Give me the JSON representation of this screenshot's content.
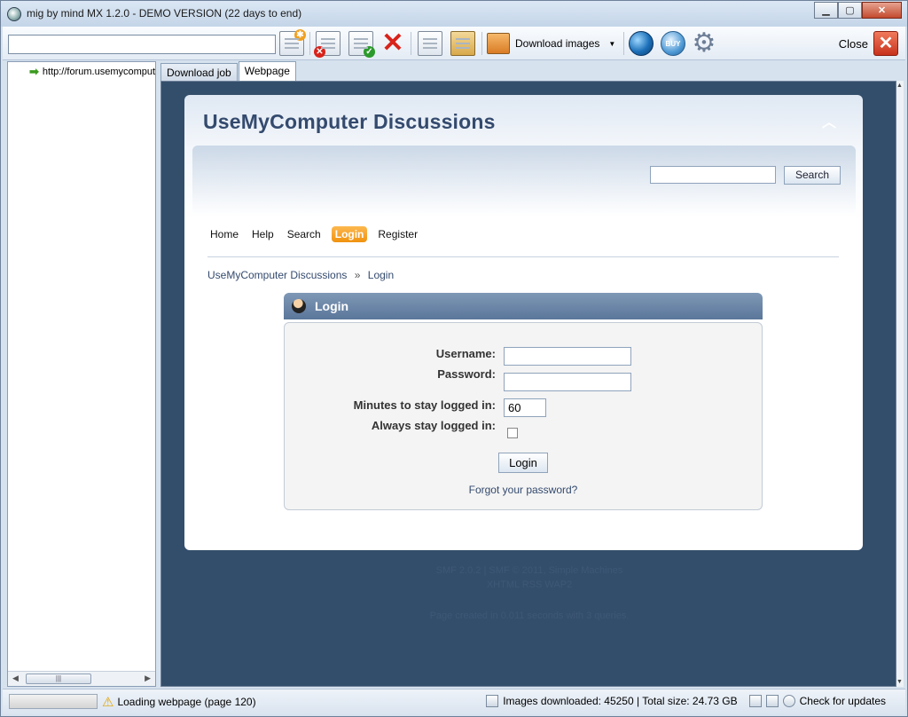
{
  "window": {
    "title": "mig by mind MX 1.2.0 - DEMO VERSION (22 days to end)",
    "minimize_icon": "minimize-icon",
    "maximize_icon": "maximize-icon",
    "close_icon": "close-icon"
  },
  "toolbar": {
    "url_value": "",
    "download_images_label": "Download images",
    "close_label": "Close"
  },
  "tree": {
    "items": [
      {
        "label": "http://forum.usemycomputer.com"
      }
    ]
  },
  "tabs": [
    {
      "label": "Download job"
    },
    {
      "label": "Webpage"
    }
  ],
  "web": {
    "forum_title": "UseMyComputer Discussions",
    "search_button": "Search",
    "search_value": "",
    "menu": [
      "Home",
      "Help",
      "Search",
      "Login",
      "Register"
    ],
    "active_menu": "Login",
    "breadcrumb": [
      "UseMyComputer Discussions",
      "Login"
    ],
    "breadcrumb_separator": "»",
    "login_title": "Login",
    "username_label": "Username:",
    "password_label": "Password:",
    "minutes_label": "Minutes to stay logged in:",
    "minutes_value": "60",
    "always_label": "Always stay logged in:",
    "login_button": "Login",
    "forgot_link": "Forgot your password?",
    "footer_line1": "SMF 2.0.2 | SMF © 2011, Simple Machines",
    "footer_line2": "XHTML   RSS   WAP2",
    "footer_line3": "Page created in 0.011 seconds with 3 queries.",
    "colors": {
      "accent": "#f0920f",
      "title": "#344a6e",
      "background": "#334e6b"
    }
  },
  "status": {
    "loading_text": "Loading webpage (page 120)",
    "stats_text": "Images downloaded: 45250 | Total size: 24.73 GB",
    "check_updates": "Check for updates"
  }
}
